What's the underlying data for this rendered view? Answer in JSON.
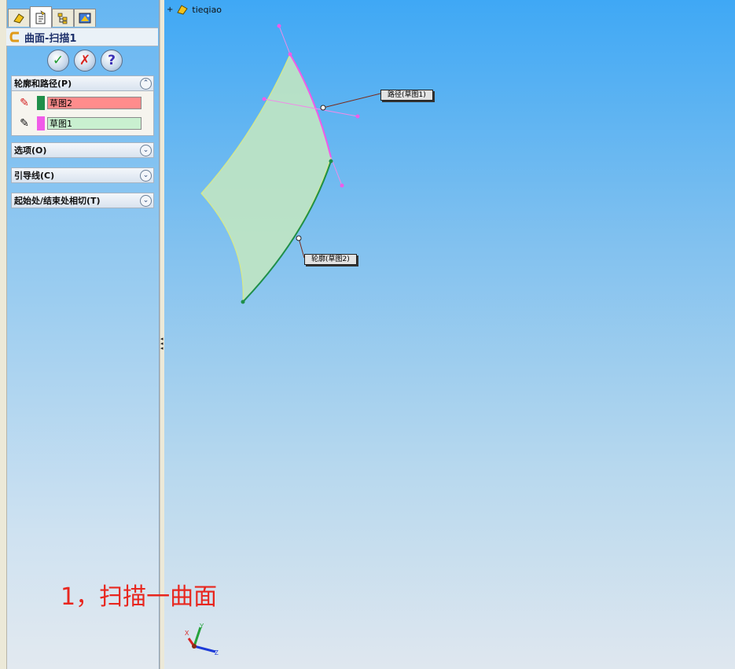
{
  "panel": {
    "title": "曲面-扫描1",
    "tabs": [
      "feature-manager-icon",
      "property-manager-icon",
      "configuration-manager-icon",
      "display-manager-icon"
    ],
    "actions": {
      "ok": "✓",
      "cancel": "✗",
      "help": "?"
    },
    "sections": [
      {
        "label": "轮廓和路径(P)",
        "expanded": true,
        "rows": [
          {
            "value": "草图2",
            "swatch": "#1f8f4a",
            "field_bg": "#ff8c8c"
          },
          {
            "value": "草图1",
            "swatch": "#f05be8",
            "field_bg": "#c9f0d0"
          }
        ]
      },
      {
        "label": "选项(O)",
        "expanded": false
      },
      {
        "label": "引导线(C)",
        "expanded": false
      },
      {
        "label": "起始处/结束处相切(T)",
        "expanded": false
      }
    ]
  },
  "viewport": {
    "tree_root": "tieqiao",
    "callouts": {
      "path": "路径(草图1)",
      "profile": "轮廓(草图2)"
    },
    "caption": "1，扫描一曲面",
    "axes": {
      "x": "X",
      "y": "Y",
      "z": "Z"
    }
  },
  "colors": {
    "surface": "#bfe5c4",
    "path_color": "#f05be8",
    "profile_color": "#1f8f4a",
    "caption": "#e8261e"
  }
}
